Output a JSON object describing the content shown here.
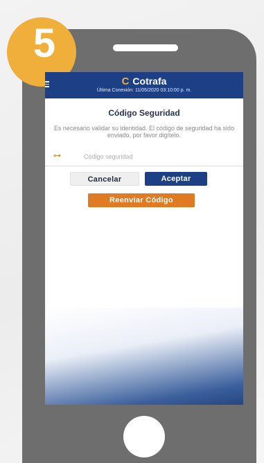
{
  "step": {
    "number": "5"
  },
  "header": {
    "brand_icon": "C",
    "brand": "Cotrafa",
    "last_connection": "Última Conexión: 11/05/2020 03:10:00 p. m."
  },
  "security": {
    "title": "Código Seguridad",
    "description": "Es necesario validar su identidad. El código de seguridad ha sido enviado, por favor digítelo.",
    "key_icon": "key-icon",
    "key_glyph": "⊶",
    "code_placeholder": "Código seguridad",
    "code_value": ""
  },
  "actions": {
    "cancel_label": "Cancelar",
    "accept_label": "Aceptar",
    "resend_label": "Reenviar Código"
  },
  "colors": {
    "badge": "#f0ae3a",
    "header": "#1d3f86",
    "accept": "#1d3f86",
    "resend": "#e07a23",
    "phone_body": "#6e6e6e"
  }
}
